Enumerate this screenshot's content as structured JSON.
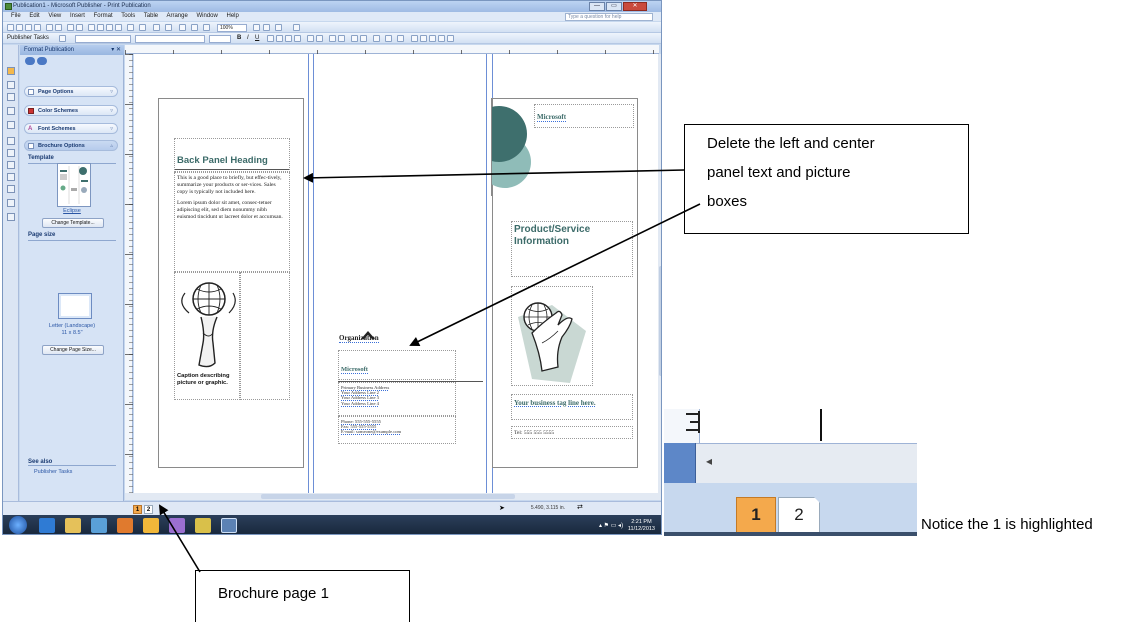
{
  "window": {
    "title": "Publication1 - Microsoft Publisher - Print Publication",
    "buttons": {
      "minimize": "—",
      "maximize": "▭",
      "close": "✕"
    }
  },
  "menu": [
    "File",
    "Edit",
    "View",
    "Insert",
    "Format",
    "Tools",
    "Table",
    "Arrange",
    "Window",
    "Help"
  ],
  "help_placeholder": "Type a question for help",
  "toolbar": {
    "zoom": "100%",
    "publisher_tasks": "Publisher Tasks"
  },
  "task_pane": {
    "title": "Format Publication",
    "sections": [
      "Page Options",
      "Color Schemes",
      "Font Schemes",
      "Brochure Options"
    ],
    "template_heading": "Template",
    "template_name": "Eclipse",
    "change_template": "Change Template...",
    "page_size_heading": "Page size",
    "page_size_name": "Letter (Landscape)",
    "page_size_dims": "11 x 8.5\"",
    "change_page_size": "Change Page Size...",
    "see_also": "See also",
    "see_also_link": "Publisher Tasks"
  },
  "brochure": {
    "left": {
      "heading": "Back Panel Heading",
      "para1": "This is a good place to briefly, but effec-tively, summarize your products or ser-vices. Sales copy is typically not included here.",
      "para2": "Lorem ipsum dolor sit amet, consec-tetuer adipiscing elit, sed diem nonummy nibh euismod tincidunt ut lacreet dolor et accumsan.",
      "caption": "Caption describing picture or graphic."
    },
    "center": {
      "org": "Organization",
      "company": "Microsoft",
      "address": [
        "Primary Business Address",
        "Your Address Line 2",
        "Your Address Line 3",
        "Your Address Line 4"
      ],
      "contact": [
        "Phone: 555-555-5555",
        "Fax: 555-555-5555",
        "E-mail: someone@example.com"
      ]
    },
    "right": {
      "company": "Microsoft",
      "heading_line1": "Product/Service",
      "heading_line2": "Information",
      "tagline": "Your business tag line here.",
      "tel": "Tel: 555 555 5555"
    }
  },
  "status": {
    "page1": "1",
    "page2": "2",
    "coords": "5.490, 3.115 in."
  },
  "clock": {
    "time": "2:21 PM",
    "date": "11/12/2013"
  },
  "callouts": {
    "delete": [
      "Delete the left and center",
      "panel text and picture",
      "boxes"
    ],
    "page1": "Brochure page 1",
    "notice": "Notice the 1 is highlighted"
  },
  "zoom": {
    "page1": "1",
    "page2": "2"
  },
  "colors": {
    "teal": "#3e6f6d",
    "heading": "#3c6b69",
    "page_highlight": "#f4a94c"
  }
}
